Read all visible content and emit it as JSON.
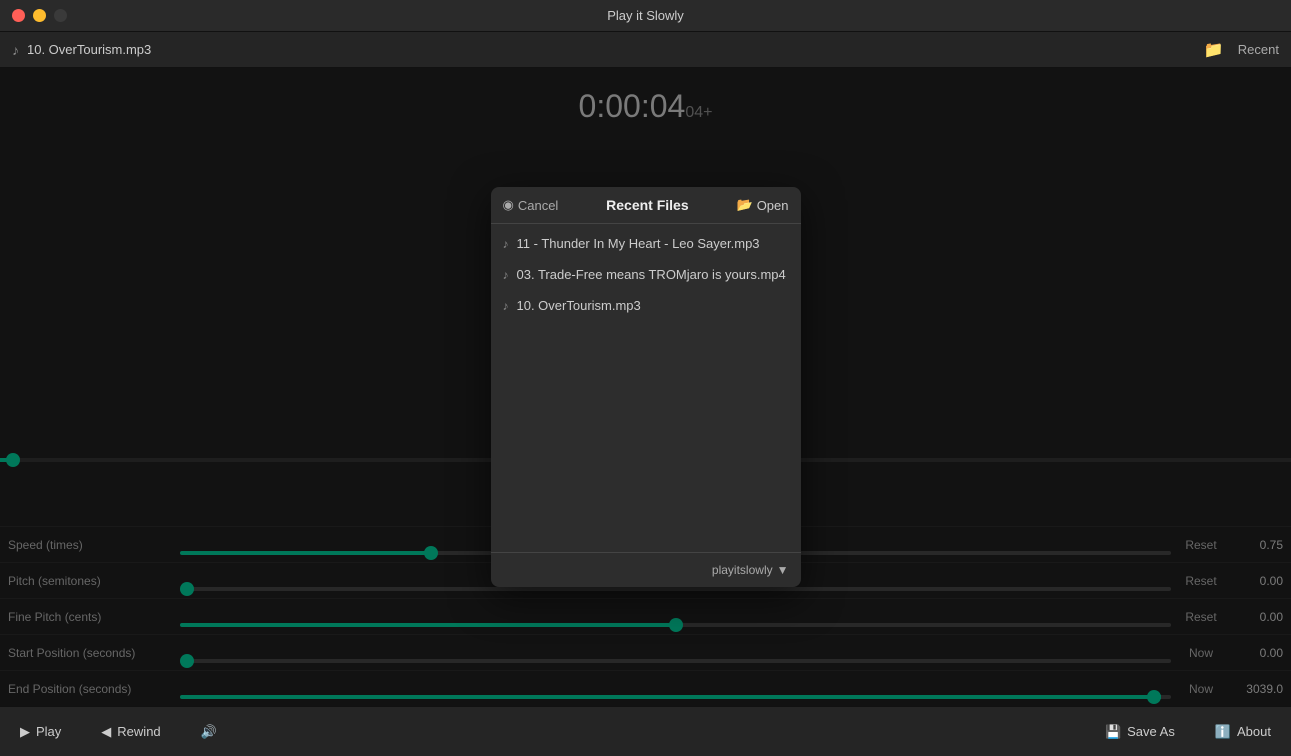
{
  "app": {
    "title": "Play it Slowly"
  },
  "titlebar": {
    "title": "Play it Slowly",
    "close_btn": "×",
    "min_btn": "−",
    "max_btn": "+"
  },
  "filebar": {
    "filename": "10. OverTourism.mp3",
    "folder_icon": "📁",
    "recent_label": "Recent"
  },
  "time": {
    "display": "0:00:04",
    "sub": "04+"
  },
  "sliders": [
    {
      "label": "Speed (times)",
      "value": "0.75",
      "reset_label": "Reset",
      "percent": 25
    },
    {
      "label": "Pitch (semitones)",
      "value": "0.00",
      "reset_label": "Reset",
      "percent": 0
    },
    {
      "label": "Fine Pitch (cents)",
      "value": "0.00",
      "reset_label": "Reset",
      "percent": 50
    },
    {
      "label": "Start Position (seconds)",
      "value": "0.00",
      "reset_label": "Now",
      "percent": 0
    },
    {
      "label": "End Position (seconds)",
      "value": "3039.0",
      "reset_label": "Now",
      "percent": 99
    }
  ],
  "toolbar": {
    "play_label": "Play",
    "rewind_label": "Rewind",
    "volume_icon": "🔊",
    "save_as_label": "Save As",
    "about_label": "About"
  },
  "modal": {
    "title": "Recent Files",
    "cancel_label": "Cancel",
    "cancel_icon": "◉",
    "open_label": "Open",
    "open_icon": "📂",
    "files": [
      {
        "name": "11 - Thunder In My Heart - Leo Sayer.mp3",
        "icon": "♪"
      },
      {
        "name": "03. Trade-Free means TROMjaro is yours.mp4",
        "icon": "♪"
      },
      {
        "name": "10. OverTourism.mp3",
        "icon": "♪"
      }
    ],
    "profile_label": "playitslowly",
    "profile_icon": "▼"
  }
}
